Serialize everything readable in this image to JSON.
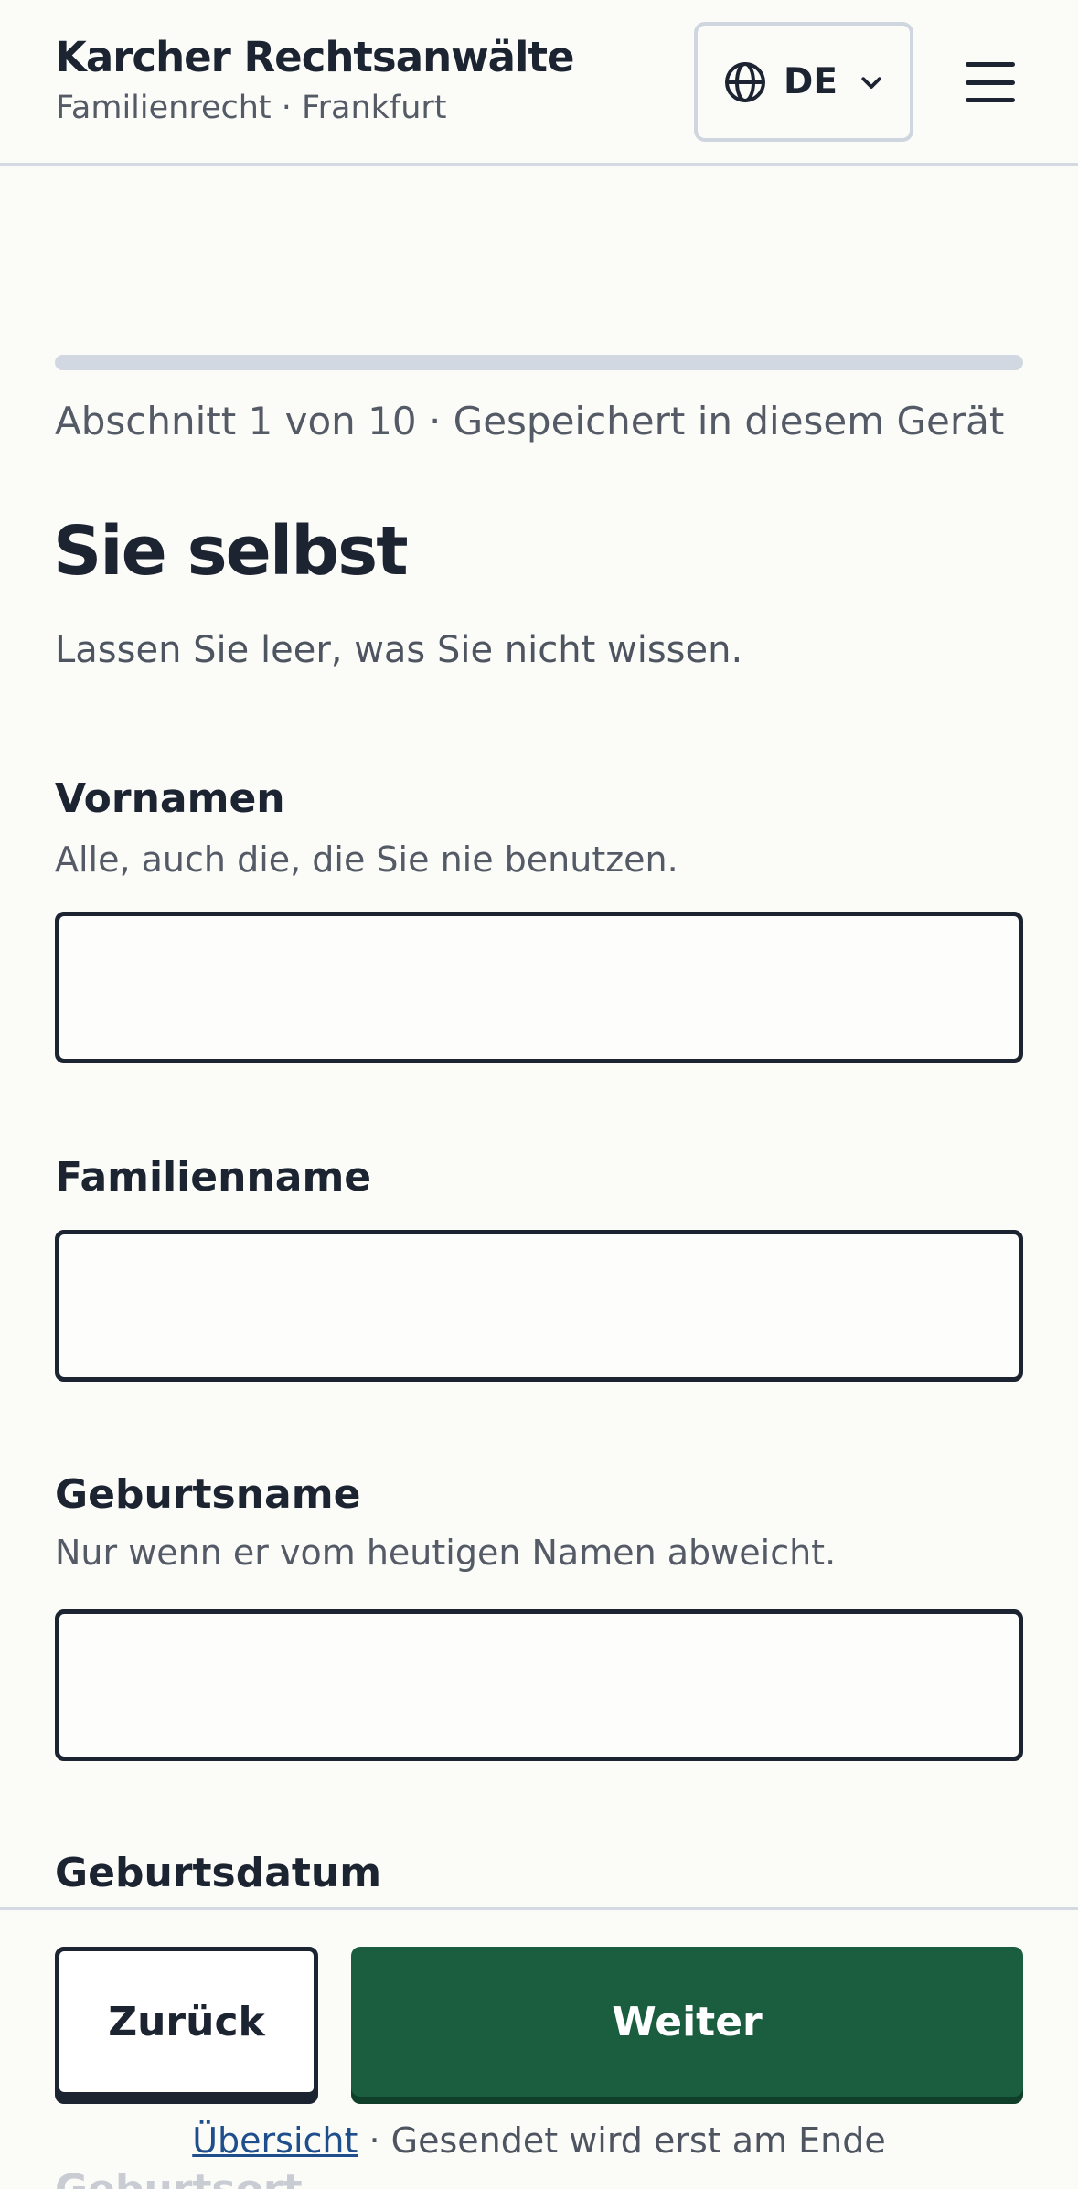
{
  "header": {
    "brand_title": "Karcher Rechtsanwälte",
    "brand_subtitle": "Familienrecht · Frankfurt",
    "language_code": "DE",
    "language_icon": "globe-icon",
    "menu_icon": "hamburger-menu-icon"
  },
  "progress": {
    "current_section": 1,
    "total_sections": 10,
    "fill_fraction": 0,
    "text": "Abschnitt 1 von 10 · Gespeichert in diesem Gerät"
  },
  "section": {
    "title": "Sie selbst",
    "intro": "Lassen Sie leer, was Sie nicht wissen."
  },
  "fields": {
    "vornamen": {
      "label": "Vornamen",
      "hint": "Alle, auch die, die Sie nie benutzen.",
      "value": ""
    },
    "familienname": {
      "label": "Familienname",
      "value": ""
    },
    "geburtsname": {
      "label": "Geburtsname",
      "hint": "Nur wenn er vom heutigen Namen abweicht.",
      "value": ""
    },
    "geburtsdatum": {
      "label": "Geburtsdatum"
    }
  },
  "footer": {
    "back_label": "Zurück",
    "next_label": "Weiter",
    "overview_link": "Übersicht",
    "note": " · Gesendet wird erst am Ende",
    "peek_label": "Geburtsort"
  },
  "colors": {
    "primary": "#1a5e3f",
    "text": "#1c2331",
    "muted": "#555b66",
    "progress_track": "#d1d8e1",
    "background": "#fbfbf8"
  }
}
